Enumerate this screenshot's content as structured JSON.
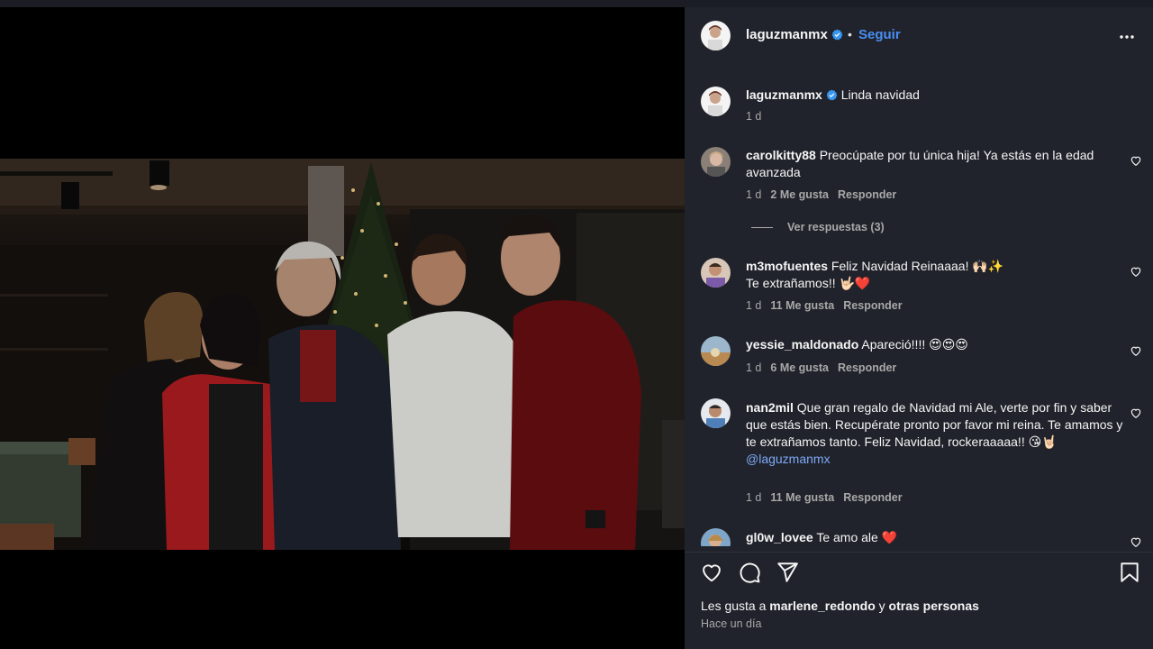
{
  "post": {
    "author": "laguzmanmx",
    "verified": true,
    "dot": "•",
    "follow_label": "Seguir",
    "more_icon": "more-horizontal-icon",
    "caption": {
      "user": "laguzmanmx",
      "text": "Linda navidad",
      "time": "1 d"
    },
    "comments": [
      {
        "user": "carolkitty88",
        "text": "Preocúpate por tu única hija! Ya estás en la edad avanzada",
        "time": "1 d",
        "likes": "2 Me gusta",
        "reply": "Responder",
        "view_replies": "Ver respuestas (3)"
      },
      {
        "user": "m3mofuentes",
        "text": "Feliz Navidad Reinaaaa! 🙌🏻✨",
        "text2": "Te extrañamos!! 🤟🏻❤️",
        "time": "1 d",
        "likes": "11 Me gusta",
        "reply": "Responder"
      },
      {
        "user": "yessie_maldonado",
        "text": "Apareció!!!! 😍😍😍",
        "time": "1 d",
        "likes": "6 Me gusta",
        "reply": "Responder"
      },
      {
        "user": "nan2mil",
        "text": "Que gran regalo de Navidad mi Ale, verte por fin y saber que estás bien. Recupérate pronto por favor mi reina. Te amamos y te extrañamos tanto. Feliz Navidad, rockeraaaaa!! 😘🤘🏻",
        "mention": "@laguzmanmx",
        "time": "1 d",
        "likes": "11 Me gusta",
        "reply": "Responder"
      },
      {
        "user": "gl0w_lovee",
        "text": "Te amo ale ❤️"
      }
    ],
    "actions": {
      "like_icon": "heart-outline-icon",
      "comment_icon": "comment-icon",
      "share_icon": "send-icon",
      "save_icon": "bookmark-icon"
    },
    "likes_line": {
      "prefix": "Les gusta a",
      "user": "marlene_redondo",
      "joiner": "y",
      "suffix": "otras personas"
    },
    "posted": "Hace un día"
  },
  "colors": {
    "panel_bg": "#20232b",
    "accent_blue": "#4a8ef5",
    "muted": "#a8a8a8"
  }
}
